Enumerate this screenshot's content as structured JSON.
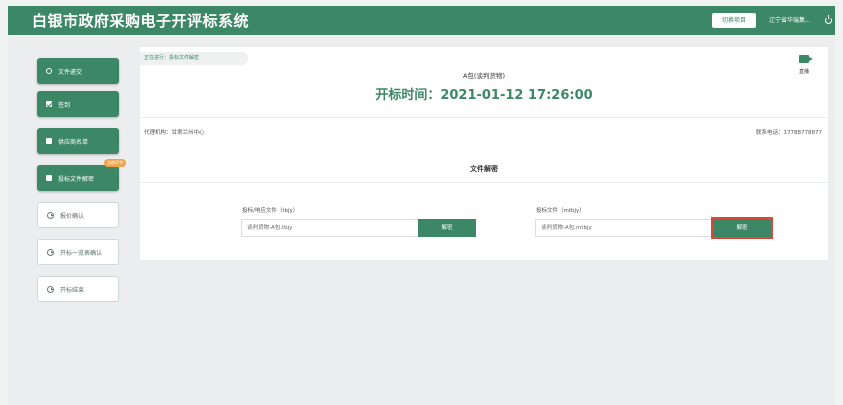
{
  "header": {
    "title": "白银市政府采购电子开评标系统",
    "switch_label": "切换项目",
    "user_name": "辽宁省华瑞集...",
    "power_icon": "power-icon"
  },
  "sidebar": {
    "items": [
      {
        "label": "文件递交",
        "icon": "circle-icon",
        "state": "active"
      },
      {
        "label": "签到",
        "icon": "check-square-icon",
        "state": "active"
      },
      {
        "label": "供应商名单",
        "icon": "list-icon",
        "state": "active"
      },
      {
        "label": "投标文件解密",
        "icon": "folder-icon",
        "state": "active",
        "badge": "当前环节"
      },
      {
        "label": "报价确认",
        "icon": "clock-icon",
        "state": "inactive"
      },
      {
        "label": "开标一览表确认",
        "icon": "clock-icon",
        "state": "inactive"
      },
      {
        "label": "开标结束",
        "icon": "clock-icon",
        "state": "inactive"
      }
    ]
  },
  "main": {
    "progress_label": "正在进行：投标文件解密",
    "package_name": "A包(谈判货物)",
    "open_time": "开标时间：2021-01-12 17:26:00",
    "live_label": "直播",
    "agency": "代理机构：甘肃兰州中心",
    "phone": "联系电话：17788778877",
    "decrypt_section_title": "文件解密",
    "left_field": {
      "label": "投标/响应文件（tbjy）",
      "value": "谈判货物-A包.tbjy",
      "button": "解密"
    },
    "right_field": {
      "label": "投标文件（mtbjy）",
      "value": "谈判货物-A包.mtbjy",
      "button": "解密"
    }
  },
  "colors": {
    "brand": "#3b8766",
    "badge": "#f0a44a",
    "highlight": "#e0453a"
  }
}
